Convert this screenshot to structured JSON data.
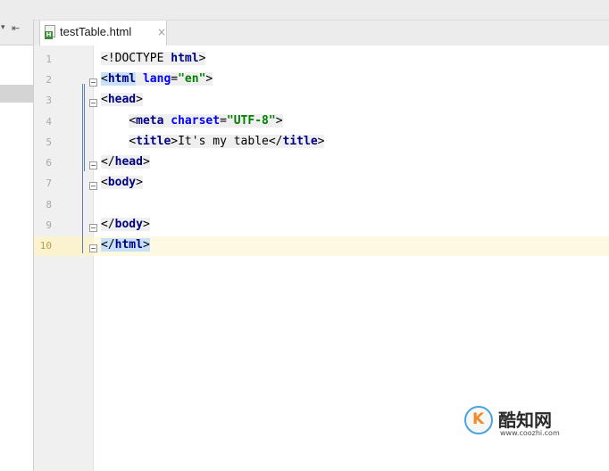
{
  "tab": {
    "file_name": "testTable.html",
    "close_glyph": "×",
    "badge": "H"
  },
  "sidebar": {
    "collapse_glyph": "▾",
    "pin_glyph": "⇤"
  },
  "gutter": {
    "line_numbers": [
      "1",
      "2",
      "3",
      "4",
      "5",
      "6",
      "7",
      "8",
      "9",
      "10"
    ]
  },
  "code": {
    "l1": {
      "open": "<!DOCTYPE ",
      "kw": "html",
      "close": ">"
    },
    "l2": {
      "open": "<",
      "tag": "html",
      "sp": " ",
      "attr": "lang",
      "eq": "=",
      "val": "\"en\"",
      "close": ">"
    },
    "l3": {
      "open": "<",
      "tag": "head",
      "close": ">"
    },
    "l4": {
      "indent": "    ",
      "open": "<",
      "tag": "meta",
      "sp": " ",
      "attr": "charset",
      "eq": "=",
      "val": "\"UTF-8\"",
      "close": ">"
    },
    "l5": {
      "indent": "    ",
      "open": "<",
      "tag": "title",
      "close": ">",
      "text": "It's my table",
      "open2": "</",
      "tag2": "title",
      "close2": ">"
    },
    "l6": {
      "open": "</",
      "tag": "head",
      "close": ">"
    },
    "l7": {
      "open": "<",
      "tag": "body",
      "close": ">"
    },
    "l9": {
      "open": "</",
      "tag": "body",
      "close": ">"
    },
    "l10": {
      "open": "</",
      "tag": "html",
      "close": ">"
    }
  },
  "watermark": {
    "logo_letter": "K",
    "title": "酷知网",
    "url": "www.coozhi.com"
  },
  "colors": {
    "tag": "#000080",
    "attr": "#0000ff",
    "value": "#008000",
    "caret_line": "#fdf9e3",
    "brace_highlight": "#c8e0f8"
  }
}
